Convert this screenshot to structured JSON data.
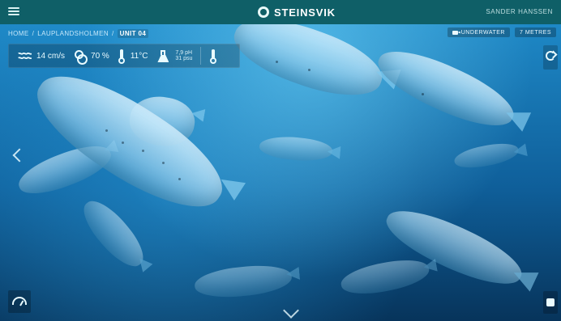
{
  "header": {
    "brand": "STEINSVIK",
    "user": "SANDER HANSSEN"
  },
  "breadcrumb": {
    "items": [
      "HOME",
      "LAUPLANDSHOLMEN"
    ],
    "separator": "/",
    "current": "UNIT 04"
  },
  "camera": {
    "mode_label": "UNDERWATER",
    "depth_label": "7 METRES"
  },
  "sensors": {
    "current_speed": "14 cm/s",
    "oxygen": "70 %",
    "temperature": "11°C",
    "ph_line1": "7,9 pH",
    "ph_line2": "31 psu"
  },
  "icons": {
    "menu": "hamburger-menu-icon",
    "brand": "steinsvik-logo",
    "wave": "wave-icon",
    "oxygen": "oxygen-icon",
    "thermo": "thermometer-icon",
    "flask": "flask-icon",
    "camera": "camera-icon",
    "left": "chevron-left-icon",
    "down": "chevron-down-icon",
    "gauge": "gauge-icon",
    "refresh": "refresh-icon",
    "snapshot": "snapshot-icon"
  },
  "colors": {
    "topbar": "#0f5f67",
    "accent": "#e9fbff",
    "water_top": "#1e88c6",
    "water_bottom": "#07345b"
  }
}
